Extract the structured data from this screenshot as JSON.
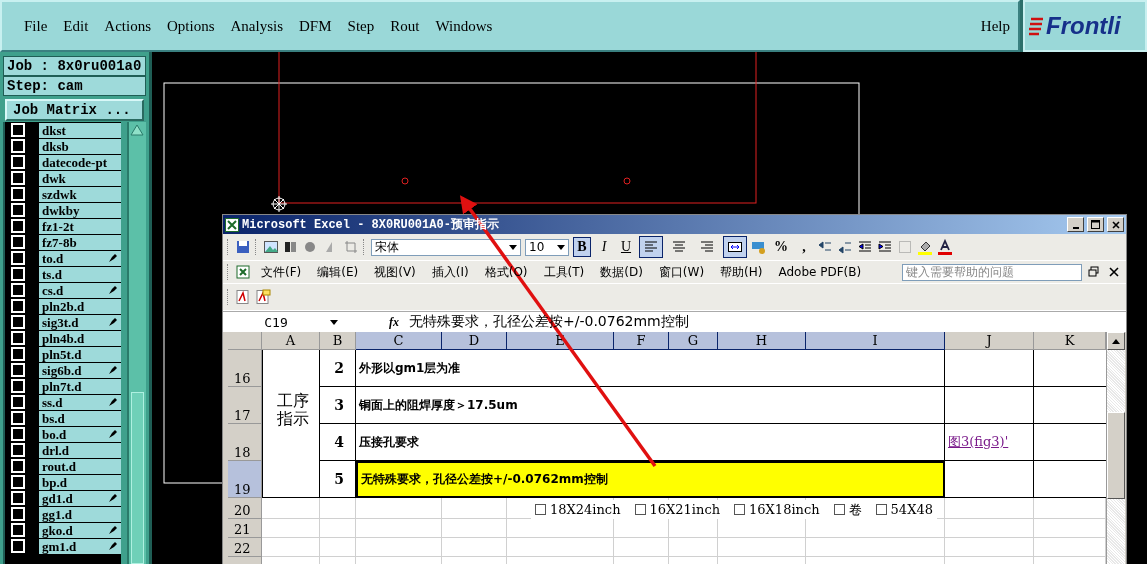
{
  "menubar": {
    "items": [
      "File",
      "Edit",
      "Actions",
      "Options",
      "Analysis",
      "DFM",
      "Step",
      "Rout",
      "Windows"
    ],
    "help": "Help",
    "logo": "Frontli"
  },
  "job_panel": {
    "job": "Job : 8x0ru001a0",
    "step": "Step: cam",
    "matrix_button": "Job Matrix ...",
    "layers": [
      {
        "name": "dkst",
        "checked": false,
        "affected": false
      },
      {
        "name": "dksb",
        "checked": false,
        "affected": false
      },
      {
        "name": "datecode-pt",
        "checked": false,
        "affected": false
      },
      {
        "name": "dwk",
        "checked": false,
        "affected": false
      },
      {
        "name": "szdwk",
        "checked": false,
        "affected": false
      },
      {
        "name": "dwkby",
        "checked": false,
        "affected": false
      },
      {
        "name": "fz1-2t",
        "checked": false,
        "affected": false
      },
      {
        "name": "fz7-8b",
        "checked": false,
        "affected": false
      },
      {
        "name": "to.d",
        "checked": false,
        "affected": true
      },
      {
        "name": "ts.d",
        "checked": false,
        "affected": false
      },
      {
        "name": "cs.d",
        "checked": false,
        "affected": true
      },
      {
        "name": "pln2b.d",
        "checked": false,
        "affected": false
      },
      {
        "name": "sig3t.d",
        "checked": false,
        "affected": true
      },
      {
        "name": "pln4b.d",
        "checked": false,
        "affected": false
      },
      {
        "name": "pln5t.d",
        "checked": false,
        "affected": false
      },
      {
        "name": "sig6b.d",
        "checked": false,
        "affected": true
      },
      {
        "name": "pln7t.d",
        "checked": false,
        "affected": false
      },
      {
        "name": "ss.d",
        "checked": false,
        "affected": true
      },
      {
        "name": "bs.d",
        "checked": false,
        "affected": false
      },
      {
        "name": "bo.d",
        "checked": false,
        "affected": true
      },
      {
        "name": "drl.d",
        "checked": false,
        "affected": false
      },
      {
        "name": "rout.d",
        "checked": false,
        "affected": false
      },
      {
        "name": "bp.d",
        "checked": false,
        "affected": false
      },
      {
        "name": "gd1.d",
        "checked": false,
        "affected": true
      },
      {
        "name": "gg1.d",
        "checked": false,
        "affected": false
      },
      {
        "name": "gko.d",
        "checked": false,
        "affected": true
      },
      {
        "name": "gm1.d",
        "checked": false,
        "affected": true
      }
    ]
  },
  "excel": {
    "title": "Microsoft Excel - 8X0RU001A0-预审指示",
    "font": "宋体",
    "font_size": "10",
    "format_buttons": [
      {
        "kind": "bold",
        "label": "B",
        "selected": true
      },
      {
        "kind": "italic",
        "label": "I",
        "selected": false
      },
      {
        "kind": "underline",
        "label": "U",
        "selected": false
      }
    ],
    "align_buttons": [
      {
        "kind": "left",
        "selected": true
      },
      {
        "kind": "center",
        "selected": false
      },
      {
        "kind": "right",
        "selected": false
      },
      {
        "kind": "merge",
        "selected": true
      }
    ],
    "number_buttons": [
      "%",
      ","
    ],
    "menu": [
      "文件(F)",
      "编辑(E)",
      "视图(V)",
      "插入(I)",
      "格式(O)",
      "工具(T)",
      "数据(D)",
      "窗口(W)",
      "帮助(H)",
      "Adobe PDF(B)"
    ],
    "help_placeholder": "键入需要帮助的问题",
    "name_box": "C19",
    "function_label": "fx",
    "formula": "无特殊要求，孔径公差按+/-0.0762mm控制",
    "columns": [
      {
        "label": "A",
        "selected": false
      },
      {
        "label": "B",
        "selected": false
      },
      {
        "label": "C",
        "selected": true
      },
      {
        "label": "D",
        "selected": true
      },
      {
        "label": "E",
        "selected": true
      },
      {
        "label": "F",
        "selected": true
      },
      {
        "label": "G",
        "selected": true
      },
      {
        "label": "H",
        "selected": true
      },
      {
        "label": "I",
        "selected": true
      },
      {
        "label": "J",
        "selected": false
      },
      {
        "label": "K",
        "selected": false
      }
    ],
    "section_label": "工序指示",
    "rows": [
      {
        "number": "16",
        "selected": false,
        "step": "2",
        "text": "外形以gm1层为准",
        "highlighted": false
      },
      {
        "number": "17",
        "selected": false,
        "step": "3",
        "text": "铜面上的阻焊厚度＞17.5um",
        "highlighted": false
      },
      {
        "number": "18",
        "selected": false,
        "step": "4",
        "text": "压接孔要求",
        "highlighted": false,
        "note": "图3(fig3)'"
      },
      {
        "number": "19",
        "selected": true,
        "step": "5",
        "text": "无特殊要求，孔径公差按+/-0.0762mm控制",
        "highlighted": true
      }
    ],
    "blank_rows": [
      {
        "number": "20",
        "selected": false
      },
      {
        "number": "21",
        "selected": false
      },
      {
        "number": "22",
        "selected": false
      }
    ],
    "options": [
      {
        "label": "18X24inch",
        "checked": false
      },
      {
        "label": "16X21inch",
        "checked": false
      },
      {
        "label": "16X18inch",
        "checked": false
      },
      {
        "label": "卷",
        "checked": false
      },
      {
        "label": "54X48",
        "checked": false
      }
    ]
  }
}
